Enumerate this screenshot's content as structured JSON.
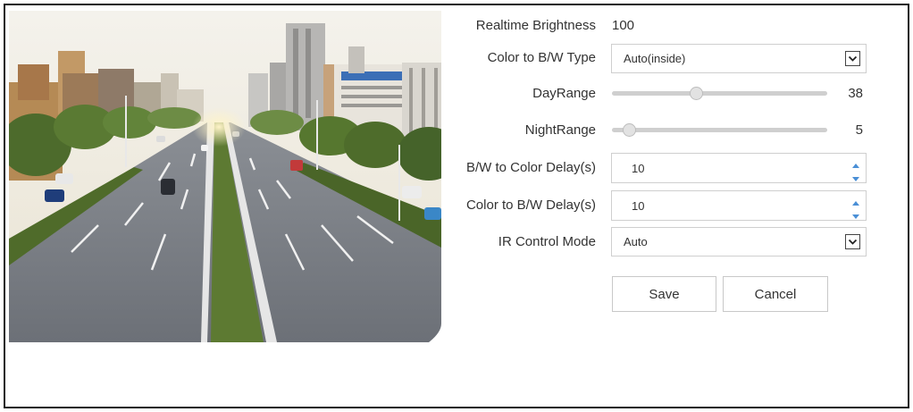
{
  "settings": {
    "realtime_brightness": {
      "label": "Realtime Brightness",
      "value": "100"
    },
    "color_to_bw_type": {
      "label": "Color to B/W Type",
      "selected": "Auto(inside)"
    },
    "day_range": {
      "label": "DayRange",
      "value": "38",
      "level": 38
    },
    "night_range": {
      "label": "NightRange",
      "value": "5",
      "level": 5
    },
    "bw_to_color_delay": {
      "label": "B/W to Color Delay(s)",
      "value": "10"
    },
    "color_to_bw_delay": {
      "label": "Color to B/W Delay(s)",
      "value": "10"
    },
    "ir_control_mode": {
      "label": "IR Control Mode",
      "selected": "Auto"
    }
  },
  "buttons": {
    "save": "Save",
    "cancel": "Cancel"
  },
  "icons": {
    "dropdown": "chevron-down-icon",
    "spin_up": "caret-up-icon",
    "spin_down": "caret-down-icon"
  },
  "colors": {
    "spinner_arrow": "#4a8fd6",
    "border": "#cfcfcf"
  }
}
